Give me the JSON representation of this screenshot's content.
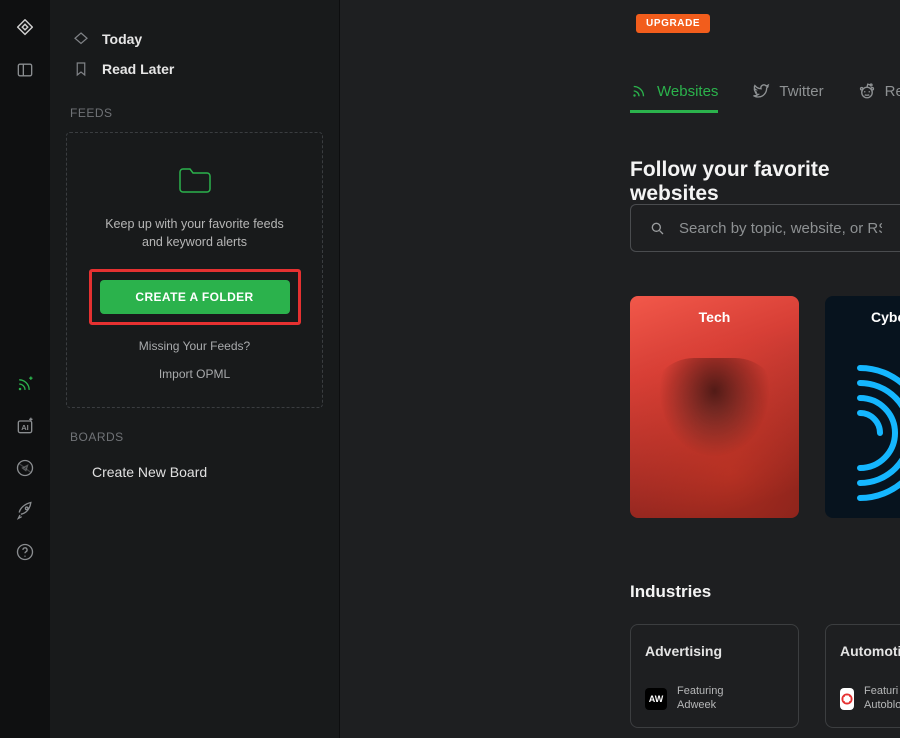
{
  "rail": {
    "items": [
      "logo",
      "panel",
      "rss-add",
      "ai",
      "compass",
      "rocket",
      "help"
    ]
  },
  "sidebar": {
    "today": "Today",
    "read_later": "Read Later",
    "feeds_label": "FEEDS",
    "feeds_blurb": "Keep up with your favorite feeds and keyword alerts",
    "create_folder_btn": "CREATE A FOLDER",
    "missing_feeds": "Missing Your Feeds?",
    "import_opml": "Import OPML",
    "boards_label": "BOARDS",
    "create_board": "Create New Board"
  },
  "main": {
    "upgrade": "UPGRADE",
    "tabs": {
      "websites": "Websites",
      "twitter": "Twitter",
      "reddit": "Redd"
    },
    "headline": "Follow your favorite websites",
    "search_placeholder": "Search by topic, website, or RSS link",
    "topics": {
      "tech": "Tech",
      "cyber": "Cyber "
    },
    "industries_label": "Industries",
    "industries": [
      {
        "title": "Advertising",
        "badge": "AW",
        "featuring_label": "Featuring",
        "featuring_source": "Adweek"
      },
      {
        "title": "Automotive",
        "badge": "",
        "featuring_label": "Featuri",
        "featuring_source": "Autoblo"
      }
    ]
  },
  "colors": {
    "accent_green": "#2bb24c",
    "accent_orange": "#f25d1c",
    "highlight_red": "#e53131"
  }
}
